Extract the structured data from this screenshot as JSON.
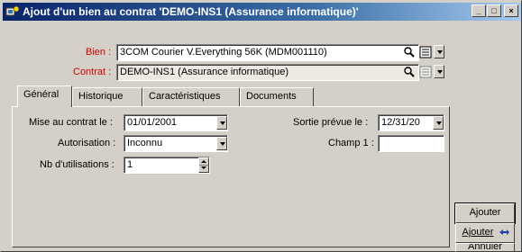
{
  "window": {
    "title": "Ajout d'un bien au contrat 'DEMO-INS1 (Assurance informatique)'",
    "minimize": "_",
    "maximize": "□",
    "close": "×"
  },
  "header": {
    "bien_label": "Bien :",
    "bien_value": "3COM Courier V.Everything 56K (MDM001110)",
    "contrat_label": "Contrat :",
    "contrat_value": "DEMO-INS1 (Assurance informatique)"
  },
  "tabs": [
    {
      "label": "Général",
      "active": true
    },
    {
      "label": "Historique",
      "active": false
    },
    {
      "label": "Caractéristiques",
      "active": false
    },
    {
      "label": "Documents",
      "active": false
    }
  ],
  "general": {
    "mise_label": "Mise au contrat le :",
    "mise_value": "01/01/2001",
    "sortie_label": "Sortie prévue le :",
    "sortie_value": "12/31/20",
    "autorisation_label": "Autorisation :",
    "autorisation_value": "Inconnu",
    "champ1_label": "Champ 1 :",
    "champ1_value": "",
    "nb_label": "Nb d'utilisations :",
    "nb_value": "1"
  },
  "buttons": {
    "ajouter": "Ajouter",
    "ajouter_plus": "Ajouter",
    "annuler": "Annuler"
  },
  "colors": {
    "titlebar_start": "#0a246a",
    "titlebar_end": "#a6caf0",
    "required_label": "#cc0000",
    "face": "#d4d0c8"
  }
}
